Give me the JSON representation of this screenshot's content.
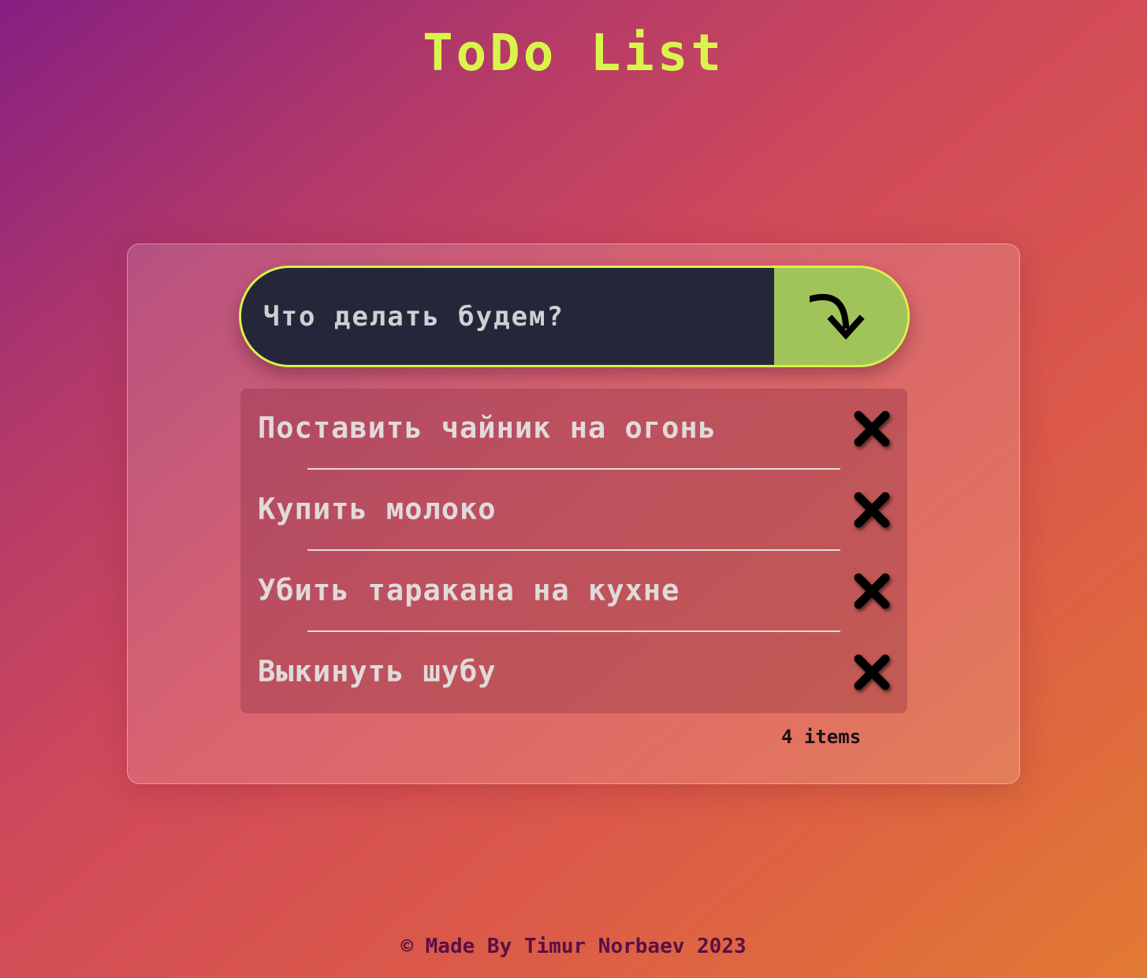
{
  "header": {
    "title": "ToDo List"
  },
  "input": {
    "placeholder": "Что делать будем?",
    "value": "",
    "add_icon": "curved-arrow-down-icon"
  },
  "todos": [
    {
      "text": "Поставить чайник на огонь",
      "delete_icon": "close-icon"
    },
    {
      "text": "Купить молоко",
      "delete_icon": "close-icon"
    },
    {
      "text": "Убить таракана на кухне",
      "delete_icon": "close-icon"
    },
    {
      "text": "Выкинуть шубу",
      "delete_icon": "close-icon"
    }
  ],
  "counter": {
    "label": "4 items"
  },
  "footer": {
    "text": "© Made By Timur Norbaev 2023"
  },
  "colors": {
    "title": "#d9f54b",
    "input_border": "#d8f24a",
    "input_background": "#26263a",
    "add_button": "#a0c45a",
    "footer_text": "#5a0f45",
    "delete_icon": "#000000"
  }
}
